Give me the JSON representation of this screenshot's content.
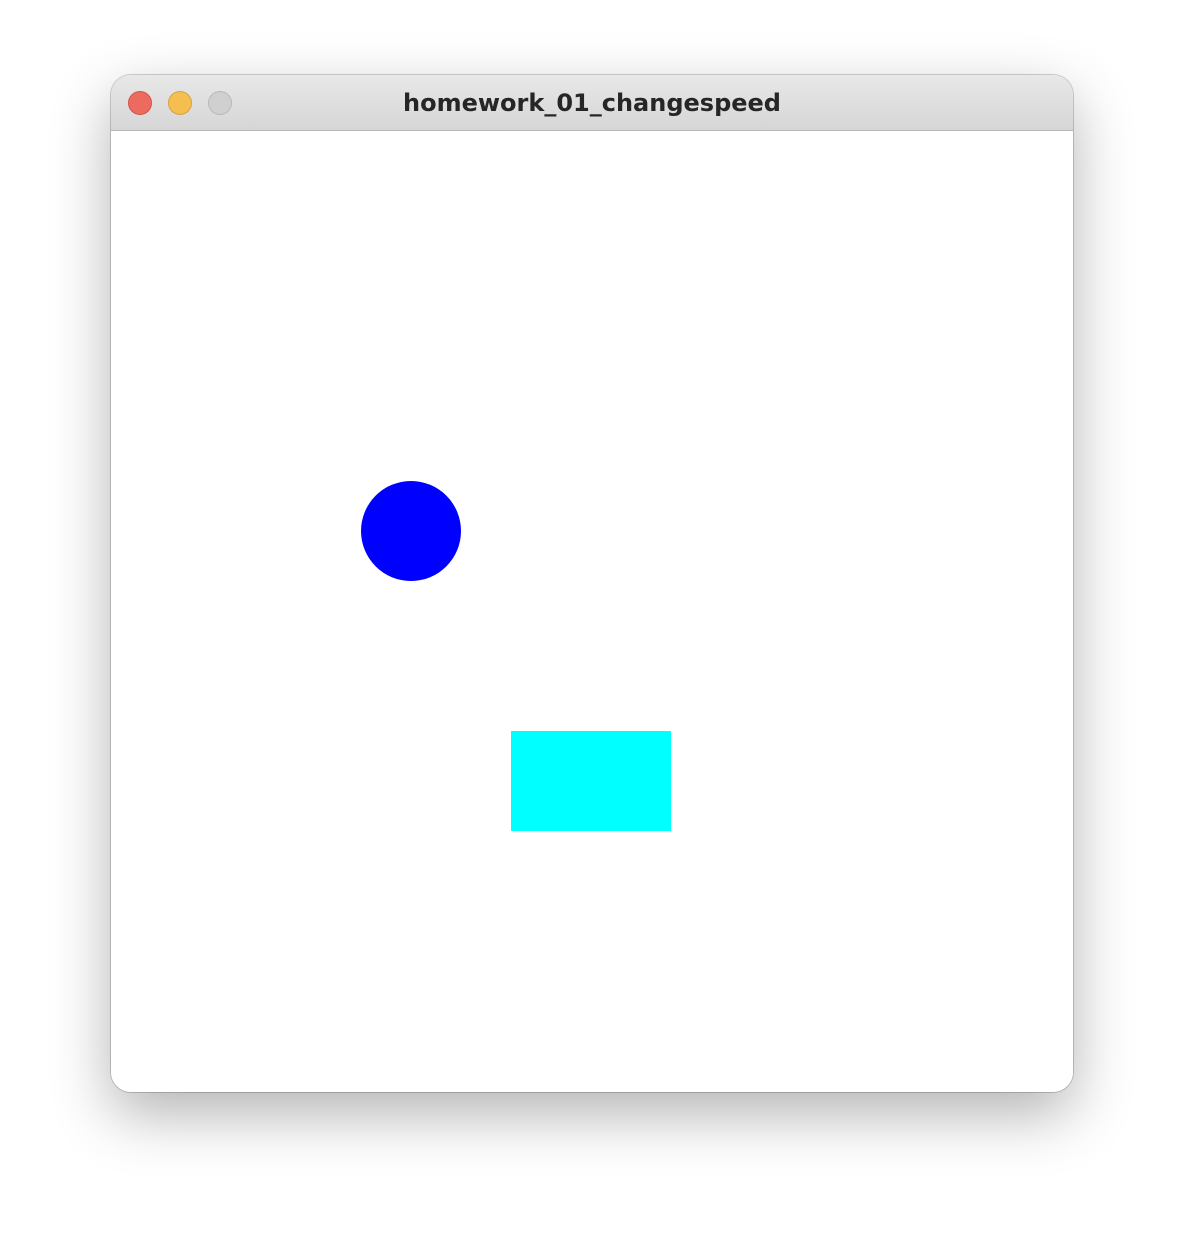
{
  "window": {
    "title": "homework_01_changespeed",
    "controls": {
      "close": "close-button",
      "minimize": "minimize-button",
      "zoom": "zoom-button"
    }
  },
  "canvas": {
    "background": "#ffffff",
    "ball": {
      "shape": "circle",
      "color": "#0000ff"
    },
    "rectangle": {
      "shape": "rectangle",
      "color": "#00ffff"
    }
  }
}
